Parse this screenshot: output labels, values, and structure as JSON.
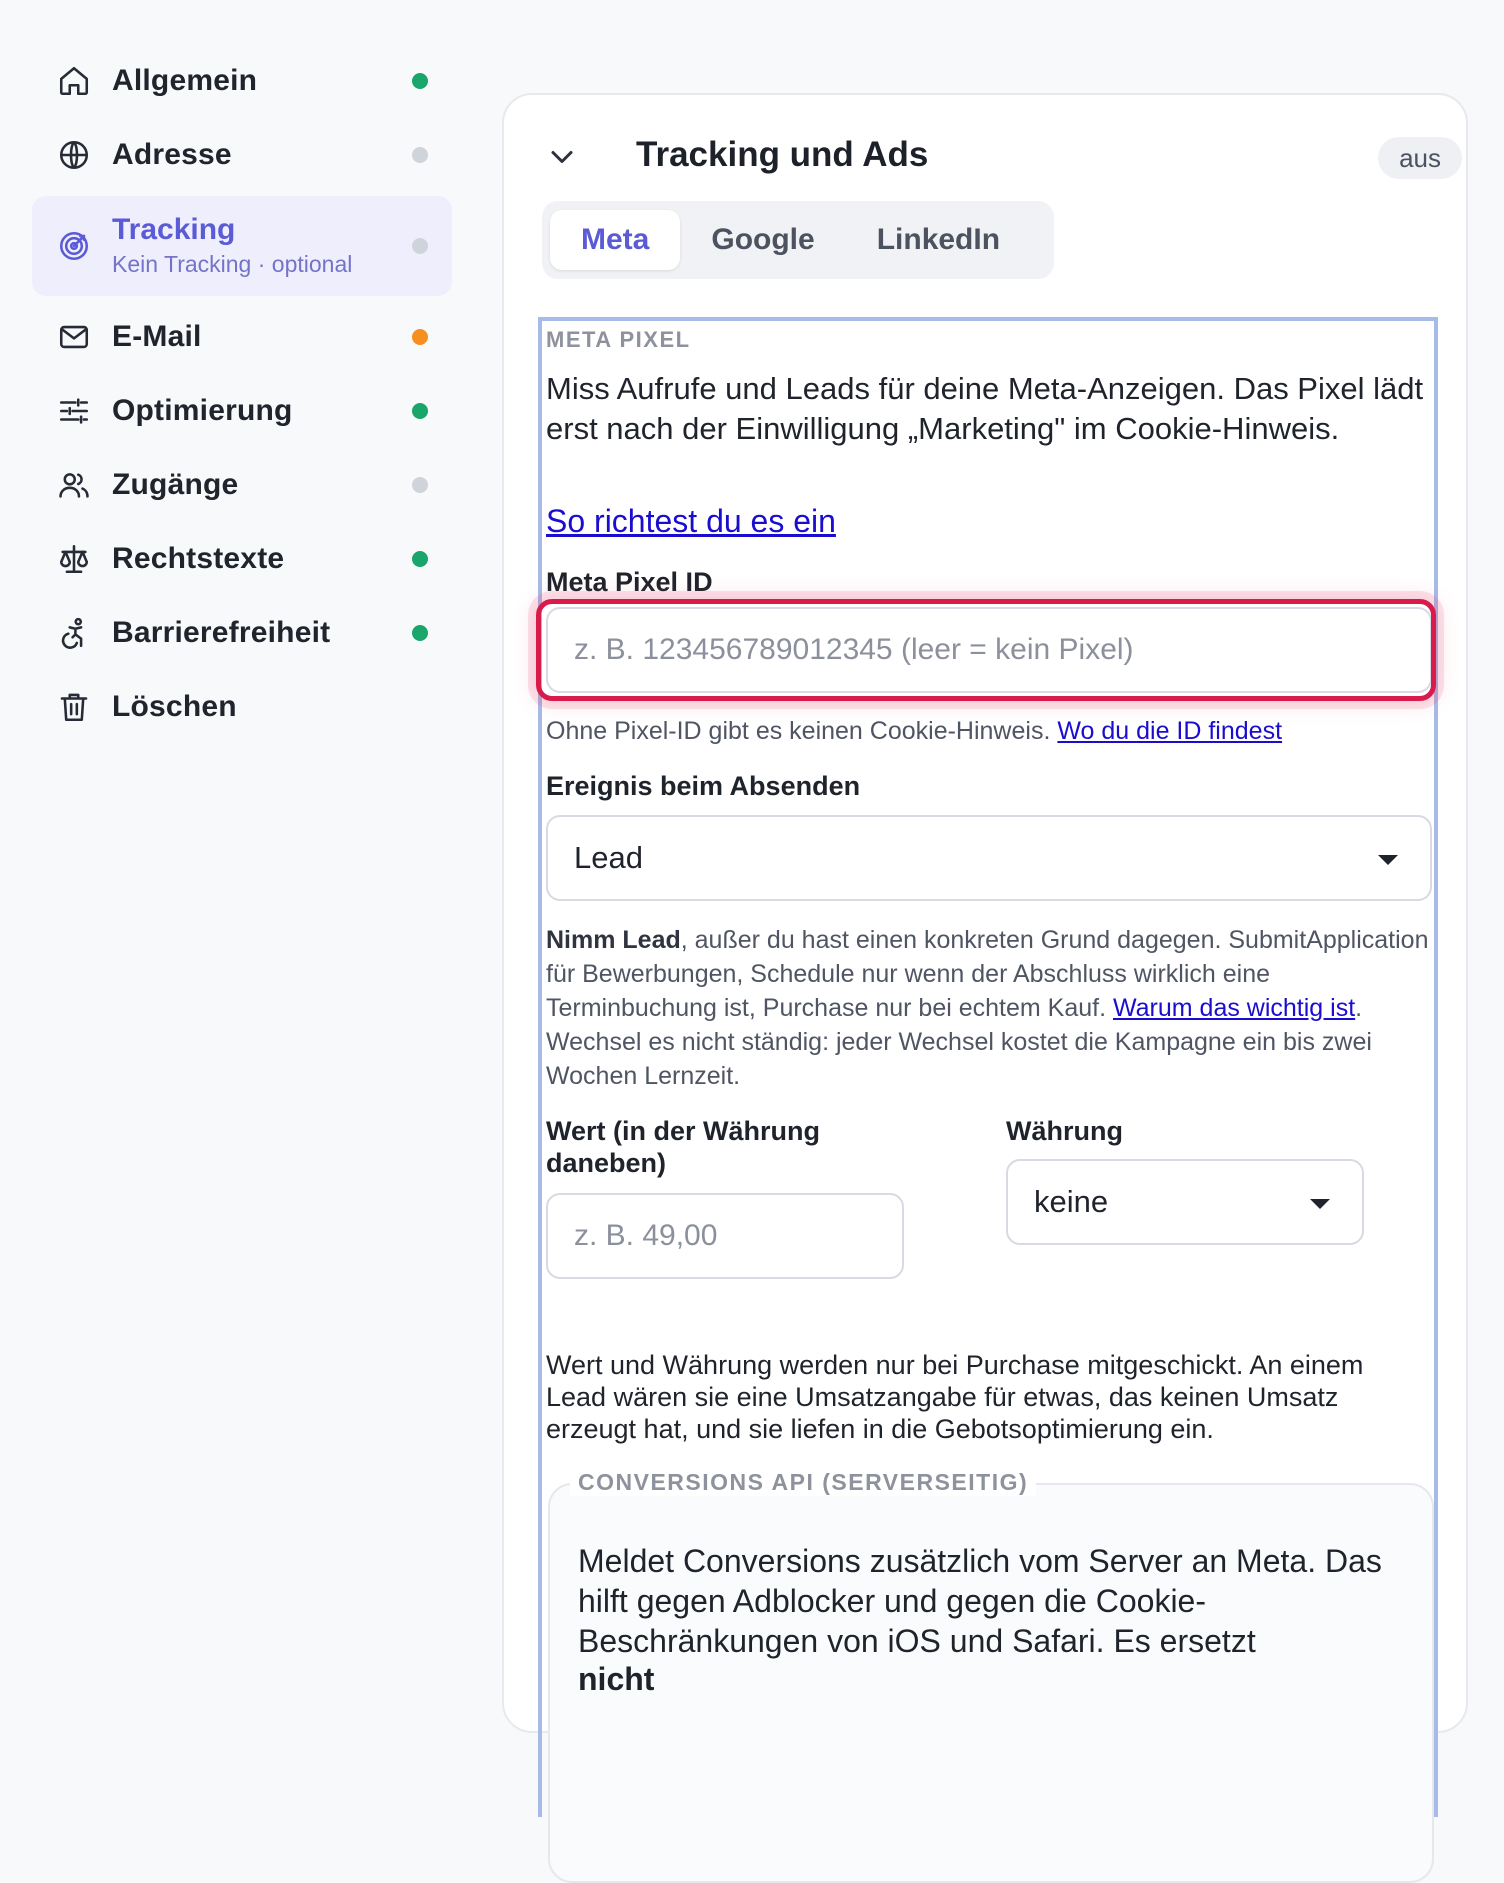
{
  "sidebar": {
    "items": [
      {
        "label": "Allgemein",
        "icon": "home-icon",
        "status": "#1aa56b"
      },
      {
        "label": "Adresse",
        "icon": "globe-icon",
        "status": "#cfd3da"
      },
      {
        "label": "Tracking",
        "sublabel": "Kein Tracking · optional",
        "icon": "target-icon",
        "status": "#cfd3da",
        "active": true
      },
      {
        "label": "E-Mail",
        "icon": "mail-icon",
        "status": "#f5901e"
      },
      {
        "label": "Optimierung",
        "icon": "sliders-icon",
        "status": "#1aa56b"
      },
      {
        "label": "Zugänge",
        "icon": "users-icon",
        "status": "#cfd3da"
      },
      {
        "label": "Rechtstexte",
        "icon": "scale-icon",
        "status": "#1aa56b"
      },
      {
        "label": "Barrierefreiheit",
        "icon": "accessibility-icon",
        "status": "#1aa56b"
      },
      {
        "label": "Löschen",
        "icon": "trash-icon"
      }
    ]
  },
  "card": {
    "title": "Tracking und Ads",
    "status": "aus",
    "tabs": [
      "Meta",
      "Google",
      "LinkedIn"
    ],
    "active_tab": "Meta"
  },
  "meta": {
    "eyebrow": "META PIXEL",
    "description": "Miss Aufrufe und Leads für deine Meta-Anzeigen. Das Pixel lädt erst nach der Einwilligung „Marketing\" im Cookie-Hinweis.",
    "guide_link": "So richtest du es ein",
    "pixel_label": "Meta Pixel ID",
    "pixel_placeholder": "z. B. 123456789012345 (leer = kein Pixel)",
    "pixel_hint": "Ohne Pixel-ID gibt es keinen Cookie-Hinweis.",
    "pixel_hint_link": "Wo du die ID findest",
    "event_label": "Ereignis beim Absenden",
    "event_value": "Lead",
    "event_help_bold": "Nimm Lead",
    "event_help_1": ", außer du hast einen konkreten Grund dagegen. SubmitApplication für Bewerbungen, Schedule nur wenn der Abschluss wirklich eine Terminbuchung ist, Purchase nur bei echtem Kauf. ",
    "event_help_link": "Warum das wichtig ist",
    "event_help_2": ". Wechsel es nicht ständig: jeder Wechsel kostet die Kampagne ein bis zwei Wochen Lernzeit.",
    "value_label": "Wert (in der Währung daneben)",
    "value_placeholder": "z. B. 49,00",
    "currency_label": "Währung",
    "currency_value": "keine",
    "value_note": "Wert und Währung werden nur bei Purchase mitgeschickt. An einem Lead wären sie eine Umsatzangabe für etwas, das keinen Umsatz erzeugt hat, und sie liefen in die Gebotsoptimierung ein.",
    "capi_legend": "CONVERSIONS API (SERVERSEITIG)",
    "capi_text": "Meldet Conversions zusätzlich vom Server an Meta. Das hilft gegen Adblocker und gegen die Cookie-Beschränkungen von iOS und Safari. Es ersetzt",
    "capi_bold": "nicht"
  },
  "colors": {
    "accent": "#5b5bd6",
    "focus": "#d81b4a",
    "frame": "#a7bbe8"
  }
}
